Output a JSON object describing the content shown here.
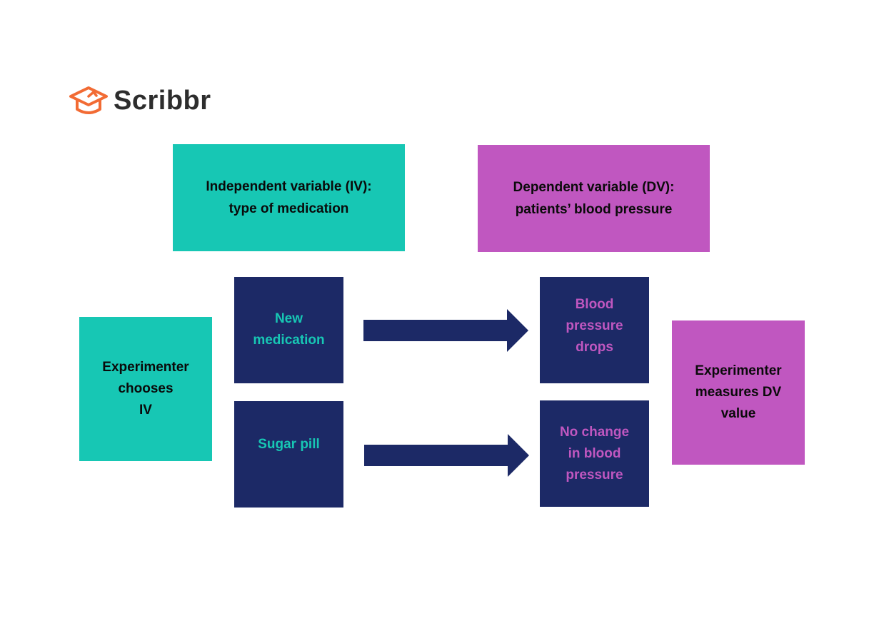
{
  "brand": {
    "name": "Scribbr",
    "icon": "graduation-cap-icon",
    "color": "#f26b34"
  },
  "colors": {
    "teal": "#17c7b4",
    "purple": "#c057c0",
    "navy": "#1c2966"
  },
  "headers": {
    "iv": "Independent variable (IV):\ntype of medication",
    "dv": "Dependent variable (DV):\npatients’ blood pressure"
  },
  "nodes": {
    "chooses": "Experimenter\nchooses\nIV",
    "new_medication": "New\nmedication",
    "sugar_pill": "Sugar pill",
    "bp_drops": "Blood\npressure\ndrops",
    "no_change": "No change\nin blood\npressure",
    "measures": "Experimenter\nmeasures DV\nvalue"
  },
  "edges": [
    {
      "from": "new_medication",
      "to": "bp_drops"
    },
    {
      "from": "sugar_pill",
      "to": "no_change"
    }
  ]
}
